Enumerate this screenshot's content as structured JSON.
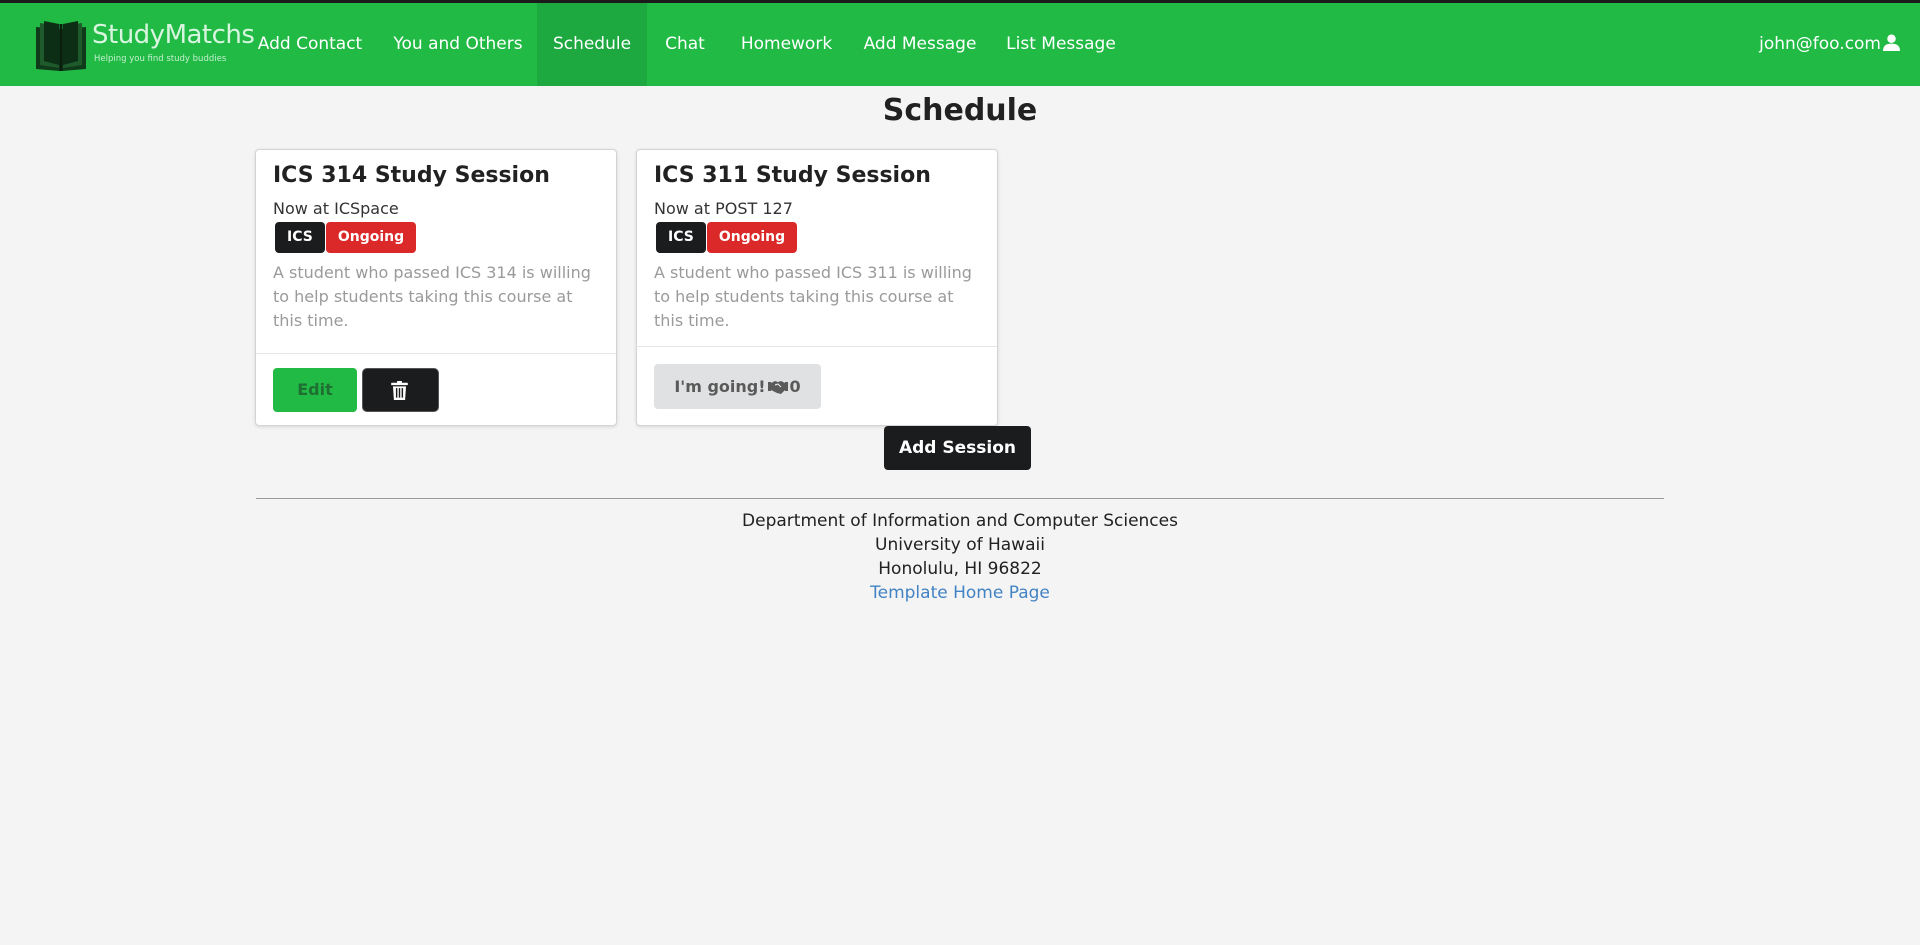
{
  "brand": {
    "name": "StudyMatchs",
    "tagline": "Helping you find study buddies"
  },
  "nav": {
    "items": [
      {
        "label": "Add Contact"
      },
      {
        "label": "You and Others"
      },
      {
        "label": "Schedule",
        "active": true
      },
      {
        "label": "Chat"
      },
      {
        "label": "Homework"
      },
      {
        "label": "Add Message"
      },
      {
        "label": "List Message"
      }
    ],
    "user": "john@foo.com"
  },
  "page": {
    "title": "Schedule"
  },
  "sessions": [
    {
      "title": "ICS 314 Study Session",
      "meta": "Now at ICSpace",
      "tags": [
        "ICS",
        "Ongoing"
      ],
      "description": "A student who passed ICS 314 is willing to help students taking this course at this time.",
      "actions": {
        "edit_label": "Edit",
        "delete_icon": "trash-icon"
      }
    },
    {
      "title": "ICS 311 Study Session",
      "meta": "Now at POST 127",
      "tags": [
        "ICS",
        "Ongoing"
      ],
      "description": "A student who passed ICS 311 is willing to help students taking this course at this time.",
      "actions": {
        "going_label": "I'm going!",
        "going_icon": "handshake-icon",
        "going_count": "0"
      }
    }
  ],
  "add_session_label": "Add Session",
  "footer": {
    "line1": "Department of Information and Computer Sciences",
    "line2": "University of Hawaii",
    "line3": "Honolulu, HI 96822",
    "link": "Template Home Page"
  },
  "colors": {
    "navbar": "#21ba45",
    "navbar_active": "#1da840",
    "tag_dark": "#1b1c1d",
    "tag_red": "#db2828",
    "link": "#4183c4",
    "background": "#f4f4f4"
  }
}
